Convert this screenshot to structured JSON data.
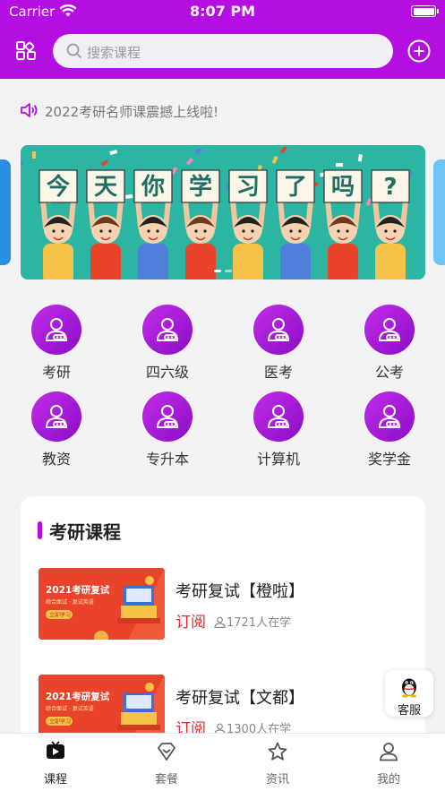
{
  "status_bar": {
    "carrier": "Carrier",
    "time": "8:07 PM"
  },
  "nav": {
    "search_placeholder": "搜索课程"
  },
  "notice": {
    "text": "2022考研名师课震撼上线啦!"
  },
  "banner": {
    "chars": [
      "今",
      "天",
      "你",
      "学",
      "习",
      "了",
      "吗",
      "?"
    ],
    "page_count": 2,
    "active_index": 0
  },
  "categories": [
    {
      "label": "考研"
    },
    {
      "label": "四六级"
    },
    {
      "label": "医考"
    },
    {
      "label": "公考"
    },
    {
      "label": "教资"
    },
    {
      "label": "专升本"
    },
    {
      "label": "计算机"
    },
    {
      "label": "奖学金"
    }
  ],
  "course_section": {
    "title": "考研课程",
    "courses": [
      {
        "title": "考研复试【橙啦】",
        "action": "订阅",
        "learners": "1721人在学",
        "thumb_title": "2021考研复试",
        "thumb_sub": "综合面试 · 复试英语",
        "thumb_btn": "立即学习"
      },
      {
        "title": "考研复试【文都】",
        "action": "订阅",
        "learners": "1300人在学",
        "thumb_title": "2021考研复试",
        "thumb_sub": "综合面试 · 复试英语",
        "thumb_btn": "立即学习"
      }
    ]
  },
  "service": {
    "label": "客服"
  },
  "tabbar": {
    "active": 0,
    "tabs": [
      {
        "label": "课程",
        "icon": "play-tv-icon"
      },
      {
        "label": "套餐",
        "icon": "diamond-icon"
      },
      {
        "label": "资讯",
        "icon": "star-icon"
      },
      {
        "label": "我的",
        "icon": "person-icon"
      }
    ]
  },
  "colors": {
    "brand": "#b40ee0",
    "accent_red": "#e6252c",
    "banner_bg": "#29b8a6"
  }
}
